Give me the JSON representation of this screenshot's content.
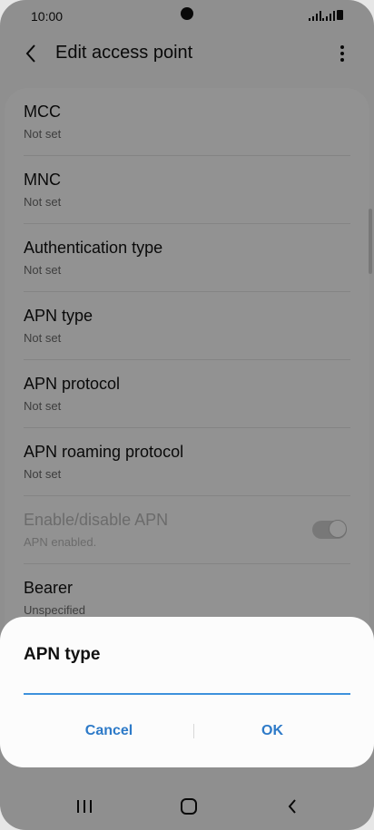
{
  "status_bar": {
    "time": "10:00",
    "icons": [
      "camera-cutout",
      "signal-icon",
      "signal-icon",
      "battery-icon"
    ]
  },
  "app_bar": {
    "title": "Edit access point",
    "back_icon": "chevron-left-icon",
    "more_icon": "more-vert-icon"
  },
  "settings": {
    "items": [
      {
        "label": "MCC",
        "value": "Not set"
      },
      {
        "label": "MNC",
        "value": "Not set"
      },
      {
        "label": "Authentication type",
        "value": "Not set"
      },
      {
        "label": "APN type",
        "value": "Not set"
      },
      {
        "label": "APN protocol",
        "value": "Not set"
      },
      {
        "label": "APN roaming protocol",
        "value": "Not set"
      },
      {
        "label": "Enable/disable APN",
        "value": "APN enabled.",
        "toggle_on": true,
        "disabled": true
      },
      {
        "label": "Bearer",
        "value": "Unspecified"
      }
    ]
  },
  "dialog": {
    "title": "APN type",
    "input_value": "",
    "cancel_label": "Cancel",
    "ok_label": "OK"
  },
  "nav_bar": {
    "icons": [
      "recents-icon",
      "home-icon",
      "back-icon"
    ]
  },
  "colors": {
    "accent": "#2d7ac8",
    "input_underline": "#3e91dc"
  }
}
